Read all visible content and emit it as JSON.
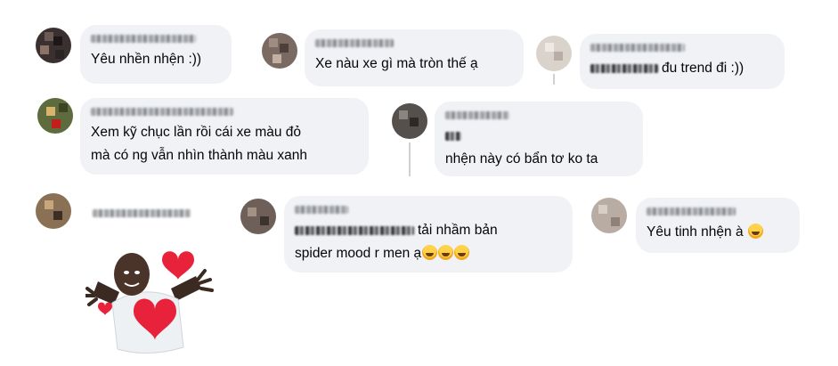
{
  "comments": [
    {
      "id": "c1",
      "text": "Yêu nhền nhện :))"
    },
    {
      "id": "c2",
      "text": "Xe nàu xe gì mà tròn thế ạ"
    },
    {
      "id": "c3",
      "text": "đu trend đi :))"
    },
    {
      "id": "c4",
      "line1": "Xem kỹ chục lần rồi cái xe màu đỏ",
      "line2": "mà có ng vẫn nhìn thành màu xanh"
    },
    {
      "id": "c5",
      "text": "nhện này có bẩn tơ ko ta"
    },
    {
      "id": "c7",
      "line1": "tải nhầm bản",
      "line2": "spider mood r men ạ"
    },
    {
      "id": "c8",
      "text": "Yêu tinh nhện à"
    }
  ],
  "sticker": {
    "name": "love-hug-sticker"
  },
  "colors": {
    "bubble": "#f0f2f5",
    "text": "#050505",
    "heart": "#e8223a"
  }
}
